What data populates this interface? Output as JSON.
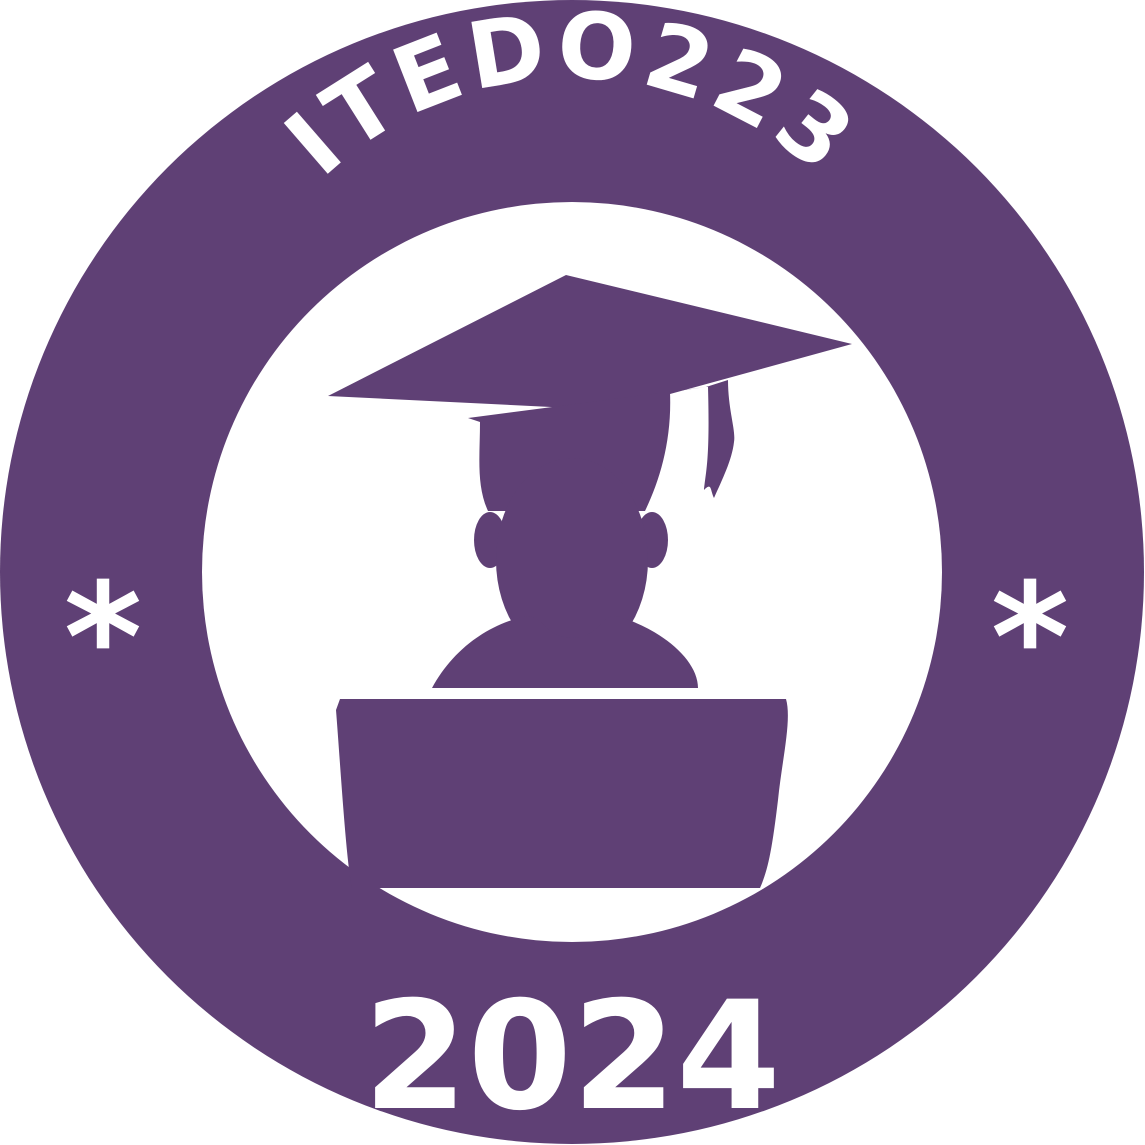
{
  "badge": {
    "top_text": "ITEDO223",
    "year": "2024",
    "left_mark": "*",
    "right_mark": "*"
  },
  "colors": {
    "primary": "#5f4075",
    "foreground": "#ffffff"
  },
  "icons": {
    "figure": "graduate-laptop-icon"
  }
}
